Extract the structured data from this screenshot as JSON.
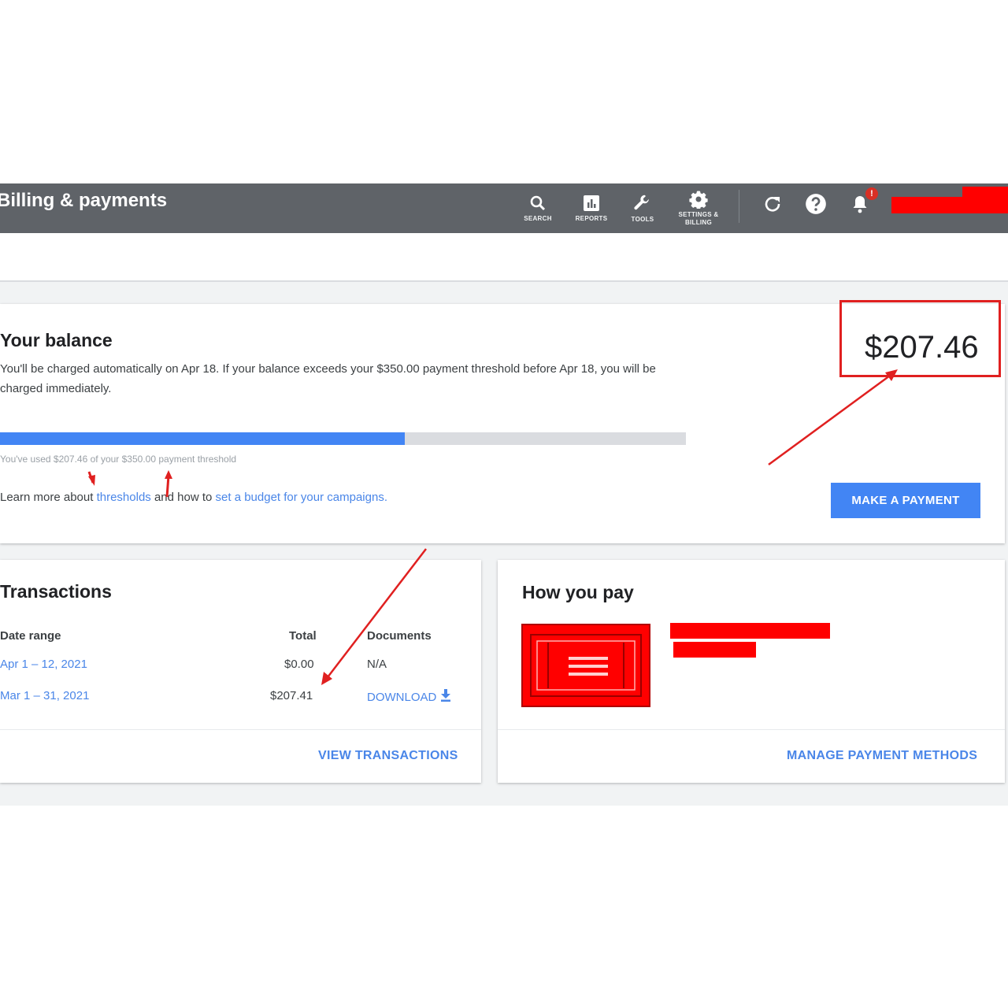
{
  "header": {
    "title": "Billing & payments",
    "nav": [
      {
        "label": "Search",
        "icon": "search-icon"
      },
      {
        "label": "Reports",
        "icon": "reports-icon"
      },
      {
        "label": "Tools",
        "icon": "wrench-icon"
      },
      {
        "label": "Settings & billing",
        "icon": "gear-icon"
      }
    ],
    "notification_badge": "!"
  },
  "balance": {
    "title": "Your balance",
    "description": "You'll be charged automatically on Apr 18. If your balance exceeds your $350.00 payment threshold before Apr 18, you will be charged immediately.",
    "amount": "$207.46",
    "threshold_used_fraction": 0.59,
    "usage_text": "You've used $207.46 of your $350.00 payment threshold",
    "learn_prefix": "Learn more about ",
    "learn_link_1": "thresholds",
    "learn_middle": " and how to ",
    "learn_link_2": "set a budget for your campaigns",
    "learn_suffix": ".",
    "button": "Make a payment"
  },
  "transactions": {
    "title": "Transactions",
    "columns": [
      "Date range",
      "Total",
      "Documents"
    ],
    "rows": [
      {
        "date": "Apr 1 – 12, 2021",
        "total": "$0.00",
        "documents": "N/A"
      },
      {
        "date": "Mar 1 – 31, 2021",
        "total": "$207.41",
        "documents": "Download"
      }
    ],
    "footer_link": "View transactions"
  },
  "how_you_pay": {
    "title": "How you pay",
    "footer_link": "Manage payment methods"
  },
  "colors": {
    "topbar": "#5f6368",
    "accent": "#4285f4",
    "link": "#4a86e8",
    "annotation": "#e02020"
  }
}
